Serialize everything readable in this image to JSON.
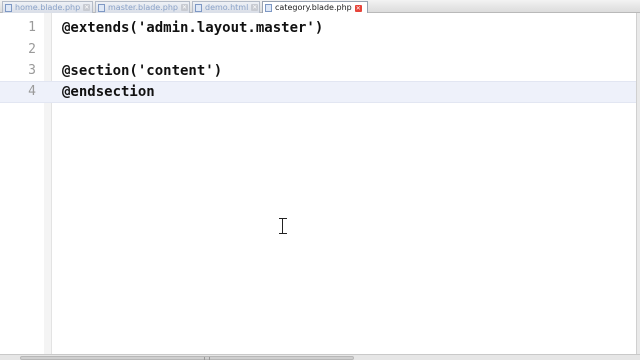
{
  "tabs": [
    {
      "label": "home.blade.php",
      "active": false
    },
    {
      "label": "master.blade.php",
      "active": false
    },
    {
      "label": "demo.html",
      "active": false
    },
    {
      "label": "category.blade.php",
      "active": true
    }
  ],
  "tab_close_glyph": "✕",
  "editor": {
    "lines": [
      {
        "number": "1",
        "code": "@extends('admin.layout.master')"
      },
      {
        "number": "2",
        "code": ""
      },
      {
        "number": "3",
        "code": "@section('content')"
      },
      {
        "number": "4",
        "code": "@endsection"
      }
    ],
    "current_line": "4"
  },
  "colors": {
    "active_tab_close": "#e7443a",
    "current_line_bg": "#eef1fa",
    "tab_text_inactive": "#8aa2c8"
  },
  "icons": {
    "tab_file": "file-icon",
    "tab_close": "close-icon",
    "cursor": "text-cursor-icon"
  }
}
